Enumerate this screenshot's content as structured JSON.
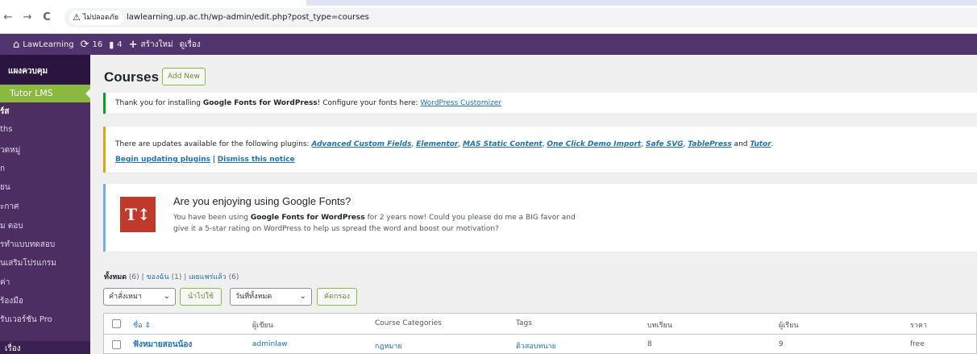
{
  "browser": {
    "back": "←",
    "forward": "→",
    "reload": "C",
    "security_label": "ไม่ปลอดภัย",
    "url": "lawlearning.up.ac.th/wp-admin/edit.php?post_type=courses"
  },
  "adminbar": {
    "site_name": "LawLearning",
    "updates_count": "16",
    "comments_count": "4",
    "new_label": "สร้างใหม่",
    "view_label": "ดูเรื่อง"
  },
  "sidebar": {
    "dashboard": "แผงควบคุม",
    "active": "Tutor LMS",
    "items": [
      "ร์ส",
      "ths",
      "วดหมู่",
      "ก",
      "ยน",
      "ะกาศ",
      "ม ตอบ",
      "รทำแบบทดสอบ",
      "นเสริมโปรแกรม",
      "ค่า",
      "ร้องมือ",
      "รับเวอร์ชัน Pro"
    ],
    "bottom": "เรื่อง"
  },
  "page": {
    "title": "Courses",
    "add_new": "Add New"
  },
  "notice_fonts": {
    "text_before": "Thank you for installing ",
    "plugin": "Google Fonts for WordPress",
    "text_after": "! Configure your fonts here: ",
    "link": "WordPress Customizer"
  },
  "notice_updates": {
    "intro": "There are updates available for the following plugins: ",
    "plugins": [
      "Advanced Custom Fields",
      "Elementor",
      "MAS Static Content",
      "One Click Demo Import",
      "Safe SVG",
      "TablePress"
    ],
    "and": " and ",
    "last_plugin": "Tutor",
    "begin": "Begin updating plugins",
    "sep": " | ",
    "dismiss": "Dismiss this notice"
  },
  "notice_review": {
    "logo": "T↕",
    "title": "Are you enjoying using Google Fonts?",
    "line1_before": "You have been using ",
    "line1_bold": "Google Fonts for WordPress",
    "line1_after": " for 2 years now! Could you please do me a BIG favor and",
    "line2": "give it a 5-star rating on WordPress to help us spread the word and boost our motivation?"
  },
  "filters": {
    "all": "ทั้งหมด",
    "all_count": "(6)",
    "mine": "ของฉัน",
    "mine_count": "(1)",
    "published": "เผยแพร่แล้ว",
    "published_count": "(6)",
    "bulk_action": "คำสั่งเหมา",
    "apply": "นำไปใช้",
    "date_filter": "วันที่ทั้งหมด",
    "filter": "คัดกรอง"
  },
  "table": {
    "columns": [
      "ชื่อ",
      "ผู้เขียน",
      "Course Categories",
      "Tags",
      "บทเรียน",
      "ผู้เรียน",
      "ราคา"
    ],
    "rows": [
      [
        "ฟังหมายสอนน้อง",
        "adminlaw",
        "กฎหมาย",
        "ติวสอบทนาย",
        "8",
        "9",
        "free"
      ]
    ]
  }
}
